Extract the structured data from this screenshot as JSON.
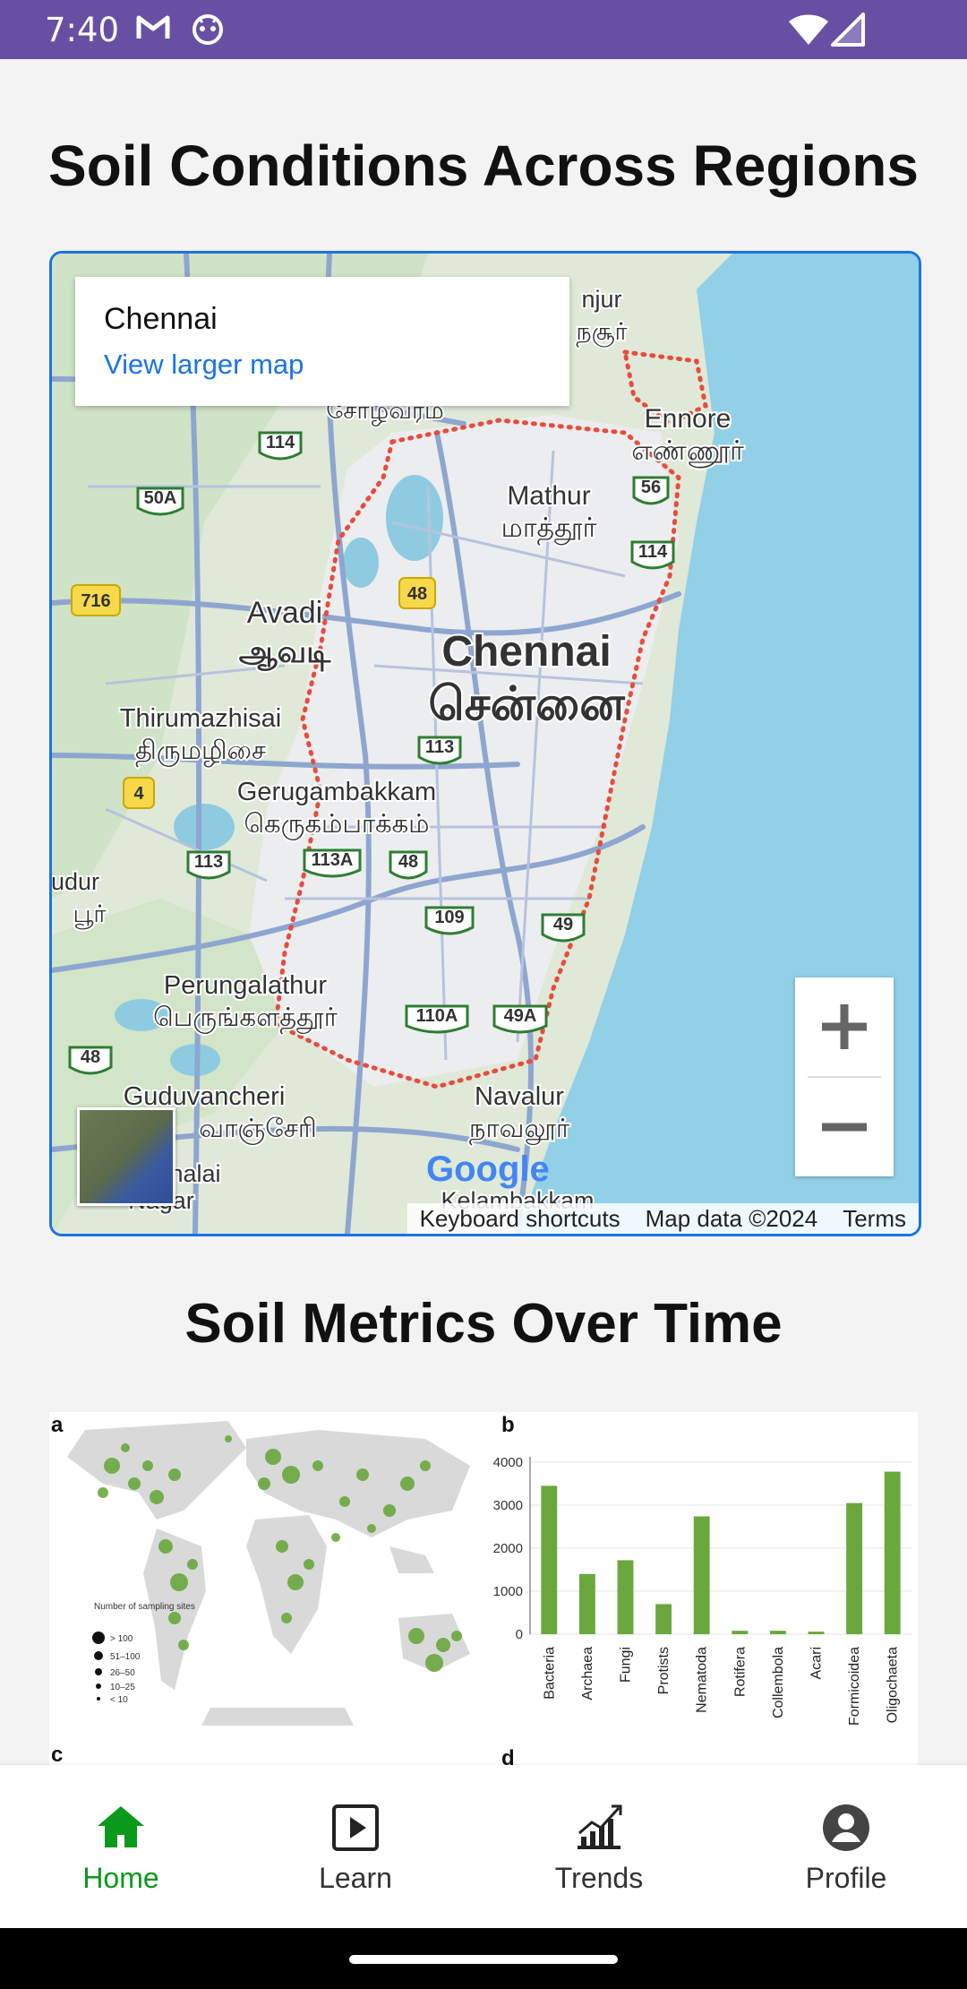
{
  "status_bar": {
    "time": "7:40",
    "background": "#6750a4"
  },
  "page": {
    "title_regions": "Soil Conditions Across Regions",
    "title_metrics": "Soil Metrics Over Time"
  },
  "map": {
    "place_name": "Chennai",
    "larger_map_link": "View larger map",
    "labels": {
      "chennai_en": "Chennai",
      "chennai_ta": "சென்னை",
      "avadi_en": "Avadi",
      "avadi_ta": "ஆவடி",
      "ennore_en": "Ennore",
      "ennore_ta": "எண்ணூர்",
      "mathur_en": "Mathur",
      "mathur_ta": "மாத்தூர்",
      "thirumazhisai_en": "Thirumazhisai",
      "thirumazhisai_ta": "திருமழிசை",
      "gerugambakkam_en": "Gerugambakkam",
      "gerugambakkam_ta": "கெருகம்பாக்கம்",
      "perungalathur_en": "Perungalathur",
      "perungalathur_ta": "பெருங்களத்தூர்",
      "navalur_en": "Navalur",
      "navalur_ta": "நாவலூர்",
      "guduvancheri_en": "Guduvancheri",
      "guduvancheri_ta": "வாஞ்சேரி",
      "kelambakkam_en": "Kelambakkam",
      "nagar": "Nagar",
      "halai": "halai",
      "udur": "udur",
      "udur_ta": "பூர்",
      "sholavaram_ta": "சோழவரம்",
      "minjur": "njur",
      "minjur_ta": "நசூர்"
    },
    "shields": [
      "114",
      "50A",
      "716",
      "48",
      "56",
      "114",
      "113",
      "4",
      "113",
      "113A",
      "48",
      "109",
      "49",
      "110A",
      "49A",
      "48"
    ],
    "footer": {
      "shortcuts": "Keyboard shortcuts",
      "map_data": "Map data ©2024",
      "terms": "Terms"
    },
    "google": "Google",
    "zoom_in_icon": "plus-icon",
    "zoom_out_icon": "minus-icon"
  },
  "figure": {
    "panel_a": {
      "letter": "a",
      "legend_title": "Number of sampling sites",
      "legend_items": [
        "> 100",
        "51–100",
        "26–50",
        "10–25",
        "< 10"
      ]
    },
    "panel_b": {
      "letter": "b"
    },
    "panel_c": {
      "letter": "c"
    },
    "panel_d": {
      "letter": "d"
    }
  },
  "chart_data": {
    "type": "bar",
    "categories": [
      "Bacteria",
      "Archaea",
      "Fungi",
      "Protists",
      "Nematoda",
      "Rotifera",
      "Collembola",
      "Acari",
      "Formicoidea",
      "Oligochaeta"
    ],
    "values": [
      3450,
      1400,
      1720,
      700,
      2740,
      80,
      80,
      60,
      3050,
      3780
    ],
    "ylim": [
      0,
      4000
    ],
    "yticks": [
      0,
      1000,
      2000,
      3000,
      4000
    ],
    "bar_color": "#6aa83e",
    "grid": true
  },
  "nav": {
    "items": [
      {
        "label": "Home",
        "icon": "home-icon",
        "active": true
      },
      {
        "label": "Learn",
        "icon": "play-box-icon",
        "active": false
      },
      {
        "label": "Trends",
        "icon": "chart-trend-icon",
        "active": false
      },
      {
        "label": "Profile",
        "icon": "account-circle-icon",
        "active": false
      }
    ],
    "active_color": "#0a9a1c"
  }
}
